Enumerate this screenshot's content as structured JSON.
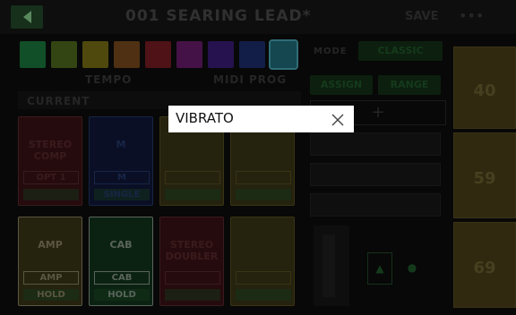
{
  "header": {
    "title": "001 SEARING LEAD*",
    "save_label": "SAVE",
    "more_icon": "•••"
  },
  "swatches": [
    "#1b7a3e",
    "#4e6b1c",
    "#7a7116",
    "#7a4a1c",
    "#7a1c22",
    "#6b1c6e",
    "#3b1c7a",
    "#1c2e6e",
    "#1f6e7a"
  ],
  "labels": {
    "tempo": "TEMPO",
    "midi_prog": "MIDI PROG",
    "current": "CURRENT",
    "mode": "MODE",
    "mode_value": "CLASSIC"
  },
  "mode_buttons": [
    "ASSIGN",
    "RANGE"
  ],
  "blocks": [
    {
      "name": "STEREO COMP",
      "sub": "OPT 1",
      "foot": "",
      "bg": "#3a1215",
      "color": "#5a2a2d"
    },
    {
      "name": "M",
      "sub": "M",
      "foot": "SINGLE",
      "bg": "#10183a",
      "color": "#243a6a"
    },
    {
      "name": "",
      "sub": "",
      "foot": "",
      "bg": "#3a3516",
      "color": "#5a5020"
    },
    {
      "name": "",
      "sub": "",
      "foot": "",
      "bg": "#3a3516",
      "color": "#5a5020"
    },
    {
      "name": "AMP",
      "sub": "AMP",
      "foot": "HOLD",
      "bg": "#3a3516",
      "color": "#8a8466"
    },
    {
      "name": "CAB",
      "sub": "CAB",
      "foot": "HOLD",
      "bg": "#12351c",
      "color": "#8a9a8d"
    },
    {
      "name": "STEREO DOUBLER",
      "sub": "",
      "foot": "",
      "bg": "#3a1215",
      "color": "#5a2a2d"
    },
    {
      "name": "",
      "sub": "",
      "foot": "",
      "bg": "#3a3516",
      "color": "#5a5020"
    }
  ],
  "side_tiles": [
    "40",
    "59",
    "69"
  ],
  "popup": {
    "title": "VIBRATO",
    "close_icon": "close-icon"
  }
}
